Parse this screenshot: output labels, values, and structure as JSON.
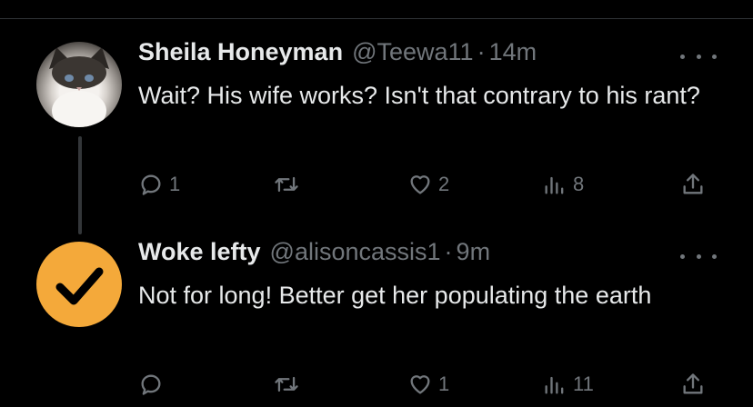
{
  "tweets": [
    {
      "name": "Sheila Honeyman",
      "handle": "@Teewa11",
      "dot": "·",
      "time": "14m",
      "text": "Wait? His wife works? Isn't that contrary to his rant?",
      "replies": "1",
      "retweets": "",
      "likes": "2",
      "views": "8",
      "avatar_icon": "cat-photo"
    },
    {
      "name": "Woke lefty",
      "handle": "@alisoncassis1",
      "dot": "·",
      "time": "9m",
      "text": "Not for long! Better get her populating the earth",
      "replies": "",
      "retweets": "",
      "likes": "1",
      "views": "11",
      "avatar_icon": "checkmark-icon"
    }
  ],
  "colors": {
    "background": "#000000",
    "primary_text": "#e7e9ea",
    "secondary_text": "#71767b",
    "avatar_accent": "#f4a93a",
    "divider": "#2f3336"
  }
}
